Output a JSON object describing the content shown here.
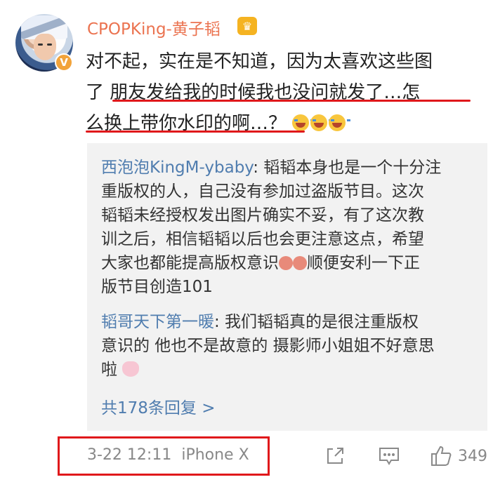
{
  "post": {
    "username": "CPOPKing-黄子韬",
    "crown_icon": "crown-icon",
    "verified_badge": "V",
    "comment_lines": [
      "对不起，实在是不知道，因为太喜欢这些图",
      "了 朋友发给我的时候我也没问就发了…怎",
      "么换上带你水印的啊…？"
    ],
    "comment_emojis": [
      "cry-laugh-emoji",
      "cry-laugh-emoji",
      "cry-laugh-emoji"
    ]
  },
  "replies": [
    {
      "user": "西泡泡KingM-ybaby",
      "lines": [
        ": 韬韬本身也是一个十分注",
        "重版权的人，自己没有参加过盗版节目。这次",
        "韬韬未经授权发出图片确实不妥，有了这次教",
        "训之后，相信韬韬以后也会更注意这点，希望",
        "大家也都能提高版权意识",
        "顺便安利一下正",
        "版节目创造101"
      ]
    },
    {
      "user": "韬哥天下第一暖",
      "lines": [
        ": 我们韬韬真的是很注重版权",
        "意识的 他也不是故意的 摄影师小姐姐不好意思",
        "啦"
      ]
    }
  ],
  "more_replies": "共178条回复 >",
  "meta": {
    "timestamp": "3-22 12:11",
    "device": "iPhone X"
  },
  "actions": {
    "share_icon": "share-icon",
    "comment_icon": "comment-icon",
    "like_icon": "thumbs-up-icon",
    "like_count": "349"
  },
  "colors": {
    "username": "#eb7350",
    "link": "#507daf",
    "highlight": "#e0181b",
    "reply_bg": "#f2f2f2"
  }
}
